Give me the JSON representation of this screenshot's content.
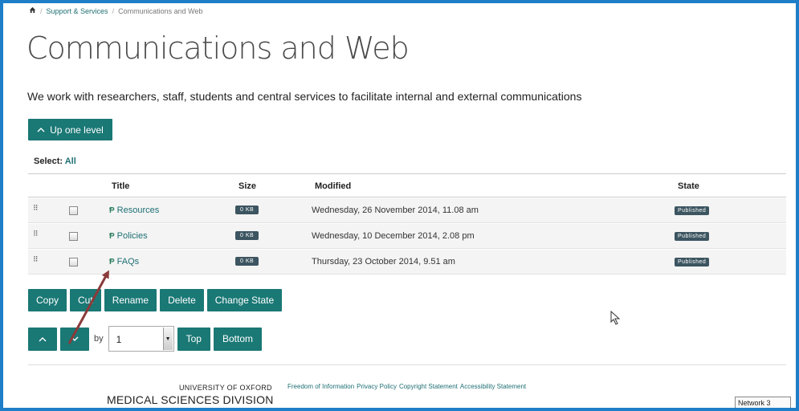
{
  "breadcrumb": {
    "home_icon": "home-icon",
    "separator": "/",
    "items": [
      "Support & Services",
      "Communications and Web"
    ]
  },
  "page": {
    "title": "Communications and Web",
    "intro": "We work with researchers, staff, students and central services to facilitate internal and external communications"
  },
  "up_level": {
    "label": "Up one level",
    "icon": "chevron-up-icon"
  },
  "select": {
    "label": "Select:",
    "all_link": "All"
  },
  "table": {
    "headers": {
      "title": "Title",
      "size": "Size",
      "modified": "Modified",
      "state": "State"
    },
    "rows": [
      {
        "title": "Resources",
        "size": "0 KB",
        "modified": "Wednesday, 26 November 2014, 11.08 am",
        "state": "Published"
      },
      {
        "title": "Policies",
        "size": "0 KB",
        "modified": "Wednesday, 10 December 2014, 2.08 pm",
        "state": "Published"
      },
      {
        "title": "FAQs",
        "size": "0 KB",
        "modified": "Thursday, 23 October 2014, 9.51 am",
        "state": "Published"
      }
    ]
  },
  "actions": {
    "copy": "Copy",
    "cut": "Cut",
    "rename": "Rename",
    "delete": "Delete",
    "change_state": "Change State"
  },
  "move": {
    "by_label": "by",
    "by_value": "1",
    "top": "Top",
    "bottom": "Bottom"
  },
  "footer": {
    "university": "UNIVERSITY OF OXFORD",
    "division": "MEDICAL SCIENCES DIVISION",
    "links": [
      "Freedom of Information",
      "Privacy Policy",
      "Copyright Statement",
      "Accessibility Statement"
    ]
  },
  "network_label": "Network 3",
  "colors": {
    "accent": "#1a7875",
    "frame": "#1e7ec8",
    "badge": "#3c5561",
    "arrow": "#8b3a3a"
  }
}
